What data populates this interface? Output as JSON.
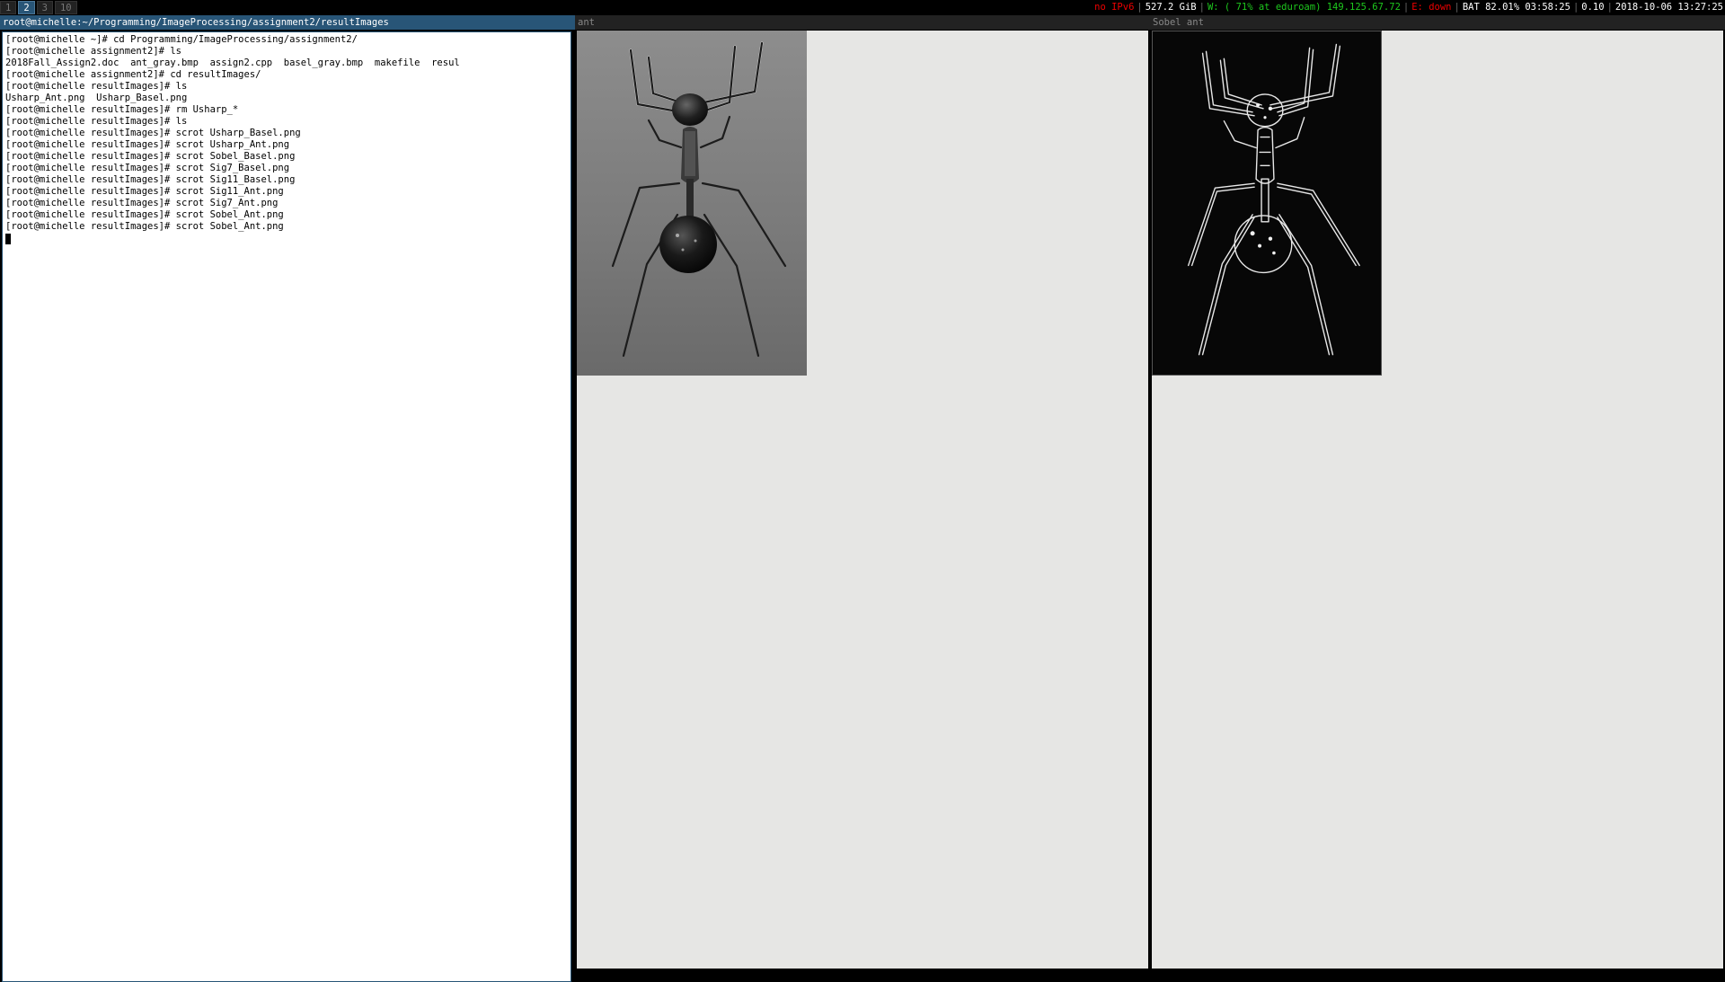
{
  "workspaces": [
    {
      "label": "1",
      "active": false
    },
    {
      "label": "2",
      "active": true
    },
    {
      "label": "3",
      "active": false
    },
    {
      "label": "10",
      "active": false
    }
  ],
  "status": {
    "ipv6": "no IPv6",
    "disk": "527.2 GiB",
    "wireless": "W: ( 71% at eduroam) 149.125.67.72",
    "ethernet": "E: down",
    "battery": "BAT 82.01% 03:58:25",
    "load": "0.10",
    "datetime": "2018-10-06 13:27:25",
    "colors": {
      "bad": "#ee0000",
      "good": "#1ec81e",
      "neutral": "#ffffff"
    }
  },
  "terminal": {
    "title": "root@michelle:~/Programming/ImageProcessing/assignment2/resultImages",
    "lines": [
      "[root@michelle ~]# cd Programming/ImageProcessing/assignment2/",
      "[root@michelle assignment2]# ls",
      "2018Fall_Assign2.doc  ant_gray.bmp  assign2.cpp  basel_gray.bmp  makefile  resul",
      "[root@michelle assignment2]# cd resultImages/",
      "[root@michelle resultImages]# ls",
      "Usharp_Ant.png  Usharp_Basel.png",
      "[root@michelle resultImages]# rm Usharp_*",
      "[root@michelle resultImages]# ls",
      "[root@michelle resultImages]# scrot Usharp_Basel.png",
      "[root@michelle resultImages]# scrot Usharp_Ant.png",
      "[root@michelle resultImages]# scrot Sobel_Basel.png",
      "[root@michelle resultImages]# scrot Sig7_Basel.png",
      "[root@michelle resultImages]# scrot Sig11_Basel.png",
      "[root@michelle resultImages]# scrot Sig11_Ant.png",
      "[root@michelle resultImages]# scrot Sig7_Ant.png",
      "[root@michelle resultImages]# scrot Sobel_Ant.png",
      "[root@michelle resultImages]# scrot Sobel_Ant.png"
    ]
  },
  "image_windows": [
    {
      "title": "ant",
      "image": "ant-photo"
    },
    {
      "title": "Sobel ant",
      "image": "ant-sobel-edges"
    }
  ]
}
